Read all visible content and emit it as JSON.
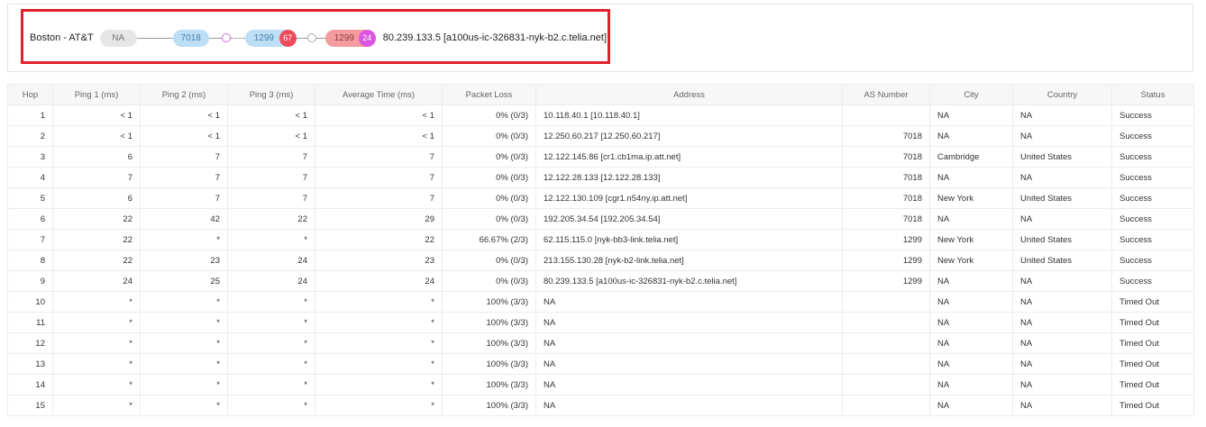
{
  "path": {
    "origin": "Boston - AT&T",
    "hops": [
      {
        "label": "NA",
        "kind": "unknown"
      },
      {
        "label": "7018",
        "kind": "as"
      },
      {
        "label": "1299",
        "kind": "as",
        "badge": "67"
      },
      {
        "label": "1299",
        "kind": "destination",
        "badge": "24"
      }
    ],
    "destination": "80.239.133.5 [a100us-ic-326831-nyk-b2.c.telia.net]"
  },
  "colors": {
    "highlight_border": "#e0202a",
    "as_pill": "#bcdff6",
    "dest_pill": "#f49ba0",
    "badge_red": "#ee4b5a",
    "badge_pink": "#dd55e0"
  },
  "table": {
    "headers": [
      "Hop",
      "Ping 1 (ms)",
      "Ping 2 (ms)",
      "Ping 3 (ms)",
      "Average Time (ms)",
      "Packet Loss",
      "Address",
      "AS Number",
      "City",
      "Country",
      "Status"
    ],
    "rows": [
      {
        "hop": "1",
        "p1": "< 1",
        "p2": "< 1",
        "p3": "< 1",
        "avg": "< 1",
        "loss": "0% (0/3)",
        "addr": "10.118.40.1 [10.118.40.1]",
        "as": "",
        "city": "NA",
        "country": "NA",
        "status": "Success"
      },
      {
        "hop": "2",
        "p1": "< 1",
        "p2": "< 1",
        "p3": "< 1",
        "avg": "< 1",
        "loss": "0% (0/3)",
        "addr": "12.250.60.217 [12.250.60.217]",
        "as": "7018",
        "city": "NA",
        "country": "NA",
        "status": "Success"
      },
      {
        "hop": "3",
        "p1": "6",
        "p2": "7",
        "p3": "7",
        "avg": "7",
        "loss": "0% (0/3)",
        "addr": "12.122.145.86 [cr1.cb1ma.ip.att.net]",
        "as": "7018",
        "city": "Cambridge",
        "country": "United States",
        "status": "Success"
      },
      {
        "hop": "4",
        "p1": "7",
        "p2": "7",
        "p3": "7",
        "avg": "7",
        "loss": "0% (0/3)",
        "addr": "12.122.28.133 [12.122.28.133]",
        "as": "7018",
        "city": "NA",
        "country": "NA",
        "status": "Success"
      },
      {
        "hop": "5",
        "p1": "6",
        "p2": "7",
        "p3": "7",
        "avg": "7",
        "loss": "0% (0/3)",
        "addr": "12.122.130.109 [cgr1.n54ny.ip.att.net]",
        "as": "7018",
        "city": "New York",
        "country": "United States",
        "status": "Success"
      },
      {
        "hop": "6",
        "p1": "22",
        "p2": "42",
        "p3": "22",
        "avg": "29",
        "loss": "0% (0/3)",
        "addr": "192.205.34.54 [192.205.34.54]",
        "as": "7018",
        "city": "NA",
        "country": "NA",
        "status": "Success"
      },
      {
        "hop": "7",
        "p1": "22",
        "p2": "*",
        "p3": "*",
        "avg": "22",
        "loss": "66.67% (2/3)",
        "addr": "62.115.115.0 [nyk-bb3-link.telia.net]",
        "as": "1299",
        "city": "New York",
        "country": "United States",
        "status": "Success"
      },
      {
        "hop": "8",
        "p1": "22",
        "p2": "23",
        "p3": "24",
        "avg": "23",
        "loss": "0% (0/3)",
        "addr": "213.155.130.28 [nyk-b2-link.telia.net]",
        "as": "1299",
        "city": "New York",
        "country": "United States",
        "status": "Success"
      },
      {
        "hop": "9",
        "p1": "24",
        "p2": "25",
        "p3": "24",
        "avg": "24",
        "loss": "0% (0/3)",
        "addr": "80.239.133.5 [a100us-ic-326831-nyk-b2.c.telia.net]",
        "as": "1299",
        "city": "NA",
        "country": "NA",
        "status": "Success"
      },
      {
        "hop": "10",
        "p1": "*",
        "p2": "*",
        "p3": "*",
        "avg": "*",
        "loss": "100% (3/3)",
        "addr": "NA",
        "as": "",
        "city": "NA",
        "country": "NA",
        "status": "Timed Out"
      },
      {
        "hop": "11",
        "p1": "*",
        "p2": "*",
        "p3": "*",
        "avg": "*",
        "loss": "100% (3/3)",
        "addr": "NA",
        "as": "",
        "city": "NA",
        "country": "NA",
        "status": "Timed Out"
      },
      {
        "hop": "12",
        "p1": "*",
        "p2": "*",
        "p3": "*",
        "avg": "*",
        "loss": "100% (3/3)",
        "addr": "NA",
        "as": "",
        "city": "NA",
        "country": "NA",
        "status": "Timed Out"
      },
      {
        "hop": "13",
        "p1": "*",
        "p2": "*",
        "p3": "*",
        "avg": "*",
        "loss": "100% (3/3)",
        "addr": "NA",
        "as": "",
        "city": "NA",
        "country": "NA",
        "status": "Timed Out"
      },
      {
        "hop": "14",
        "p1": "*",
        "p2": "*",
        "p3": "*",
        "avg": "*",
        "loss": "100% (3/3)",
        "addr": "NA",
        "as": "",
        "city": "NA",
        "country": "NA",
        "status": "Timed Out"
      },
      {
        "hop": "15",
        "p1": "*",
        "p2": "*",
        "p3": "*",
        "avg": "*",
        "loss": "100% (3/3)",
        "addr": "NA",
        "as": "",
        "city": "NA",
        "country": "NA",
        "status": "Timed Out"
      }
    ]
  }
}
